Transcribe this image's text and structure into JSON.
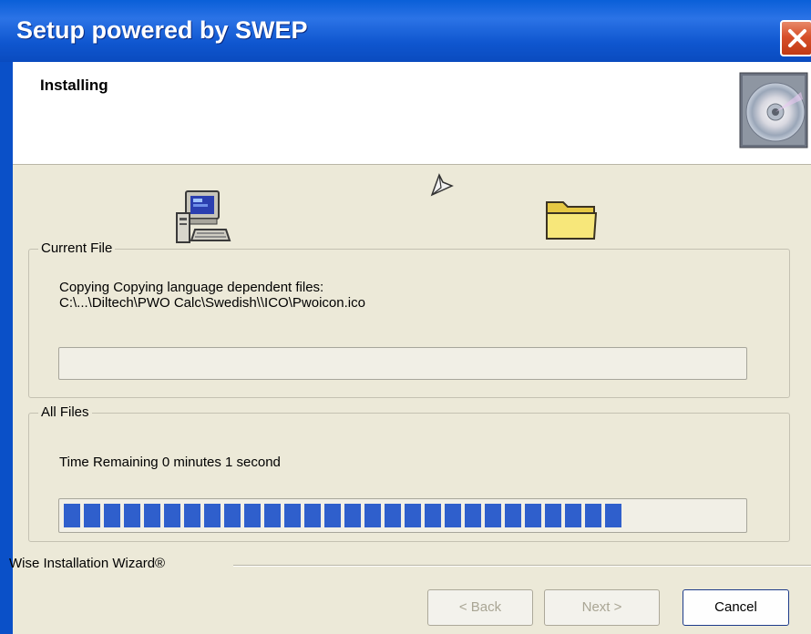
{
  "window": {
    "title": "Setup powered by SWEP"
  },
  "header": {
    "title": "Installing"
  },
  "current_file": {
    "label": "Current File",
    "line1": "Copying Copying language dependent files:",
    "line2": "C:\\...\\Diltech\\PWO Calc\\Swedish\\\\ICO\\Pwoicon.ico",
    "progress": 0
  },
  "all_files": {
    "label": "All Files",
    "time_remaining": "Time Remaining 0 minutes 1 second",
    "progress": 0.83
  },
  "footer": {
    "brand": "Wise Installation Wizard®",
    "back_label": "< Back",
    "next_label": "Next >",
    "cancel_label": "Cancel"
  },
  "icons": {
    "close": "close-icon",
    "cd": "cd-disc-icon",
    "computer": "computer-icon",
    "paper": "flying-paper-icon",
    "folder": "folder-icon"
  },
  "colors": {
    "titlebar": "#0a5fd8",
    "progress_fill": "#2f5fcc",
    "dialog_bg": "#ece9d8"
  }
}
